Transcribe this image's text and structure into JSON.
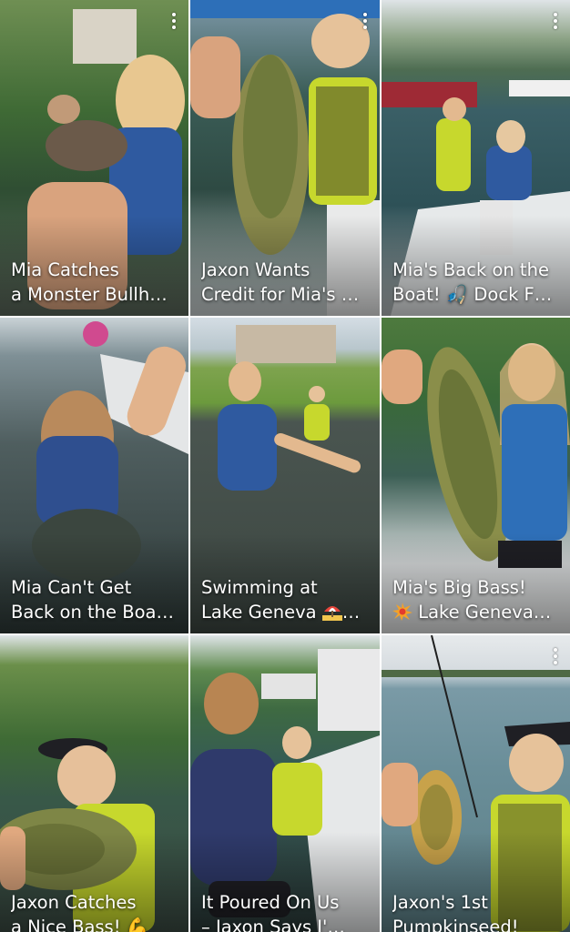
{
  "videos": [
    {
      "line1": "Mia Catches",
      "line2": "a Monster Bullh…"
    },
    {
      "line1": "Jaxon Wants",
      "line2": "Credit for Mia's …"
    },
    {
      "line1": "Mia's Back on the",
      "line2": "Boat! 🎣 Dock F…"
    },
    {
      "line1": "Mia Can't Get",
      "line2": "Back on the Boa…"
    },
    {
      "line1": "Swimming at",
      "line2": "Lake Geneva",
      "emoji": "beach-umbrella-icon"
    },
    {
      "line1": "Mia's Big Bass!",
      "line2": "Lake Geneva…",
      "emoji": "collision-icon"
    },
    {
      "line1": "Jaxon Catches",
      "line2": "a Nice Bass! 💪"
    },
    {
      "line1": "It Poured On Us",
      "line2": "– Jaxon Says I'…"
    },
    {
      "line1": "Jaxon's 1st",
      "line2": "Pumpkinseed!"
    }
  ],
  "menu_icon": "more-vertical-icon"
}
